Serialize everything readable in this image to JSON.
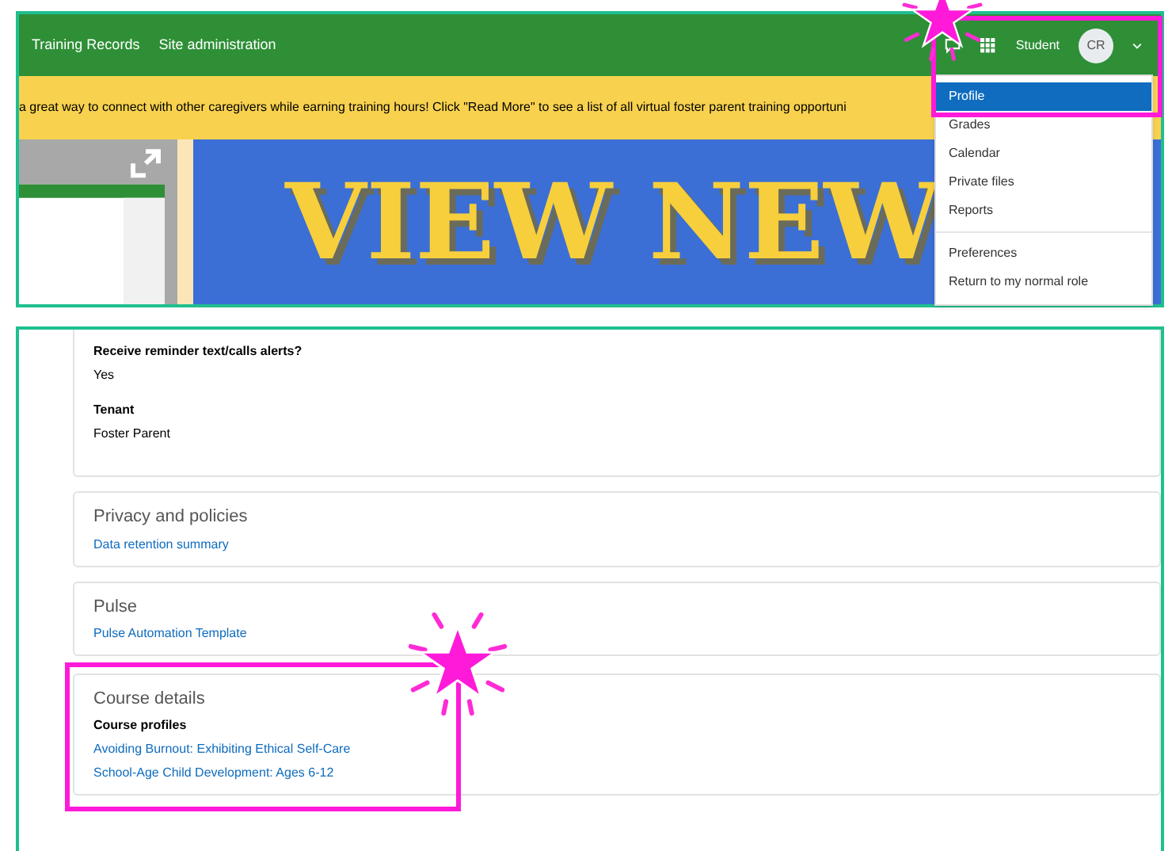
{
  "top_screen": {
    "nav": {
      "links": [
        "Training Records",
        "Site administration"
      ],
      "user_name": "Student",
      "avatar_initials": "CR"
    },
    "notice": "a great way to connect with other caregivers while earning training hours! Click \"Read More\" to see a list of all virtual foster parent training opportuni",
    "banner": {
      "headline": "VIEW NEW"
    },
    "user_menu": [
      {
        "label": "Profile",
        "selected": true
      },
      {
        "label": "Grades",
        "selected": false
      },
      {
        "label": "Calendar",
        "selected": false
      },
      {
        "label": "Private files",
        "selected": false
      },
      {
        "label": "Reports",
        "selected": false,
        "divider_after": true
      },
      {
        "label": "Preferences",
        "selected": false
      },
      {
        "label": "Return to my normal role",
        "selected": false
      }
    ]
  },
  "bottom_screen": {
    "cards": [
      {
        "fields": [
          {
            "label": "Receive reminder text/calls alerts?",
            "value": "Yes"
          },
          {
            "label": "Tenant",
            "value": "Foster Parent"
          }
        ]
      },
      {
        "title": "Privacy and policies",
        "links": [
          "Data retention summary"
        ]
      },
      {
        "title": "Pulse",
        "links": [
          "Pulse Automation Template"
        ]
      },
      {
        "title": "Course details",
        "subtitle": "Course profiles",
        "links": [
          "Avoiding Burnout: Exhibiting Ethical Self-Care",
          "School-Age Child Development: Ages 6-12"
        ],
        "highlighted": true
      }
    ]
  }
}
